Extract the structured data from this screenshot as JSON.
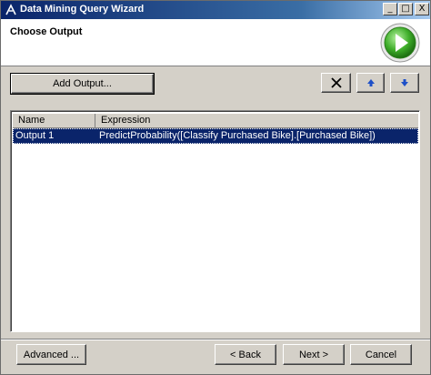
{
  "window": {
    "title": "Data Mining Query Wizard",
    "minimize_glyph": "_",
    "maximize_glyph": "□",
    "close_glyph": "X"
  },
  "header": {
    "title": "Choose Output",
    "icon": "green-play-icon"
  },
  "toolbar": {
    "add_output_label": "Add Output...",
    "delete_icon": "delete-x-icon",
    "move_up_icon": "arrow-up-icon",
    "move_down_icon": "arrow-down-icon",
    "accent_color": "#1e50c8"
  },
  "grid": {
    "columns": [
      "Name",
      "Expression"
    ],
    "rows": [
      {
        "name": "Output 1",
        "expression": "PredictProbability([Classify Purchased Bike].[Purchased Bike])",
        "selected": true
      }
    ],
    "selection_color": "#0a246a"
  },
  "footer": {
    "advanced_label": "Advanced ...",
    "back_label": "< Back",
    "next_label": "Next >",
    "cancel_label": "Cancel"
  }
}
